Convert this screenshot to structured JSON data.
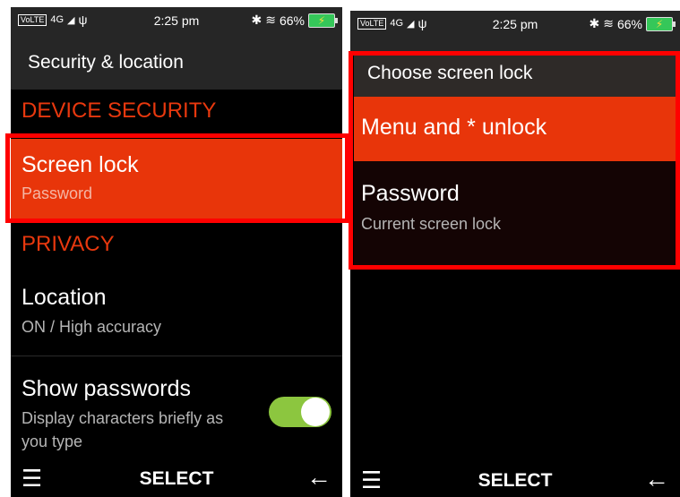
{
  "left": {
    "status": {
      "network": "VoLTE",
      "signal": "4G",
      "time": "2:25 pm",
      "battery": "66%"
    },
    "title": "Security & location",
    "sections": {
      "device_security": "DEVICE SECURITY",
      "privacy": "PRIVACY"
    },
    "screen_lock": {
      "title": "Screen lock",
      "subtitle": "Password"
    },
    "location": {
      "title": "Location",
      "subtitle": "ON / High accuracy"
    },
    "show_passwords": {
      "title": "Show passwords",
      "subtitle_line1": "Display characters briefly as",
      "subtitle_line2": "you type",
      "enabled": true
    },
    "softkeys": {
      "center": "SELECT"
    }
  },
  "right": {
    "status": {
      "network": "VoLTE",
      "signal": "4G",
      "time": "2:25 pm",
      "battery": "66%"
    },
    "title": "Choose screen lock",
    "options": [
      {
        "title": "Menu and * unlock"
      },
      {
        "title": "Password",
        "subtitle": "Current screen lock"
      }
    ],
    "softkeys": {
      "center": "SELECT"
    }
  },
  "colors": {
    "accent": "#e8350a",
    "highlight_box": "#ff0000",
    "toggle_on": "#8cc63f"
  }
}
